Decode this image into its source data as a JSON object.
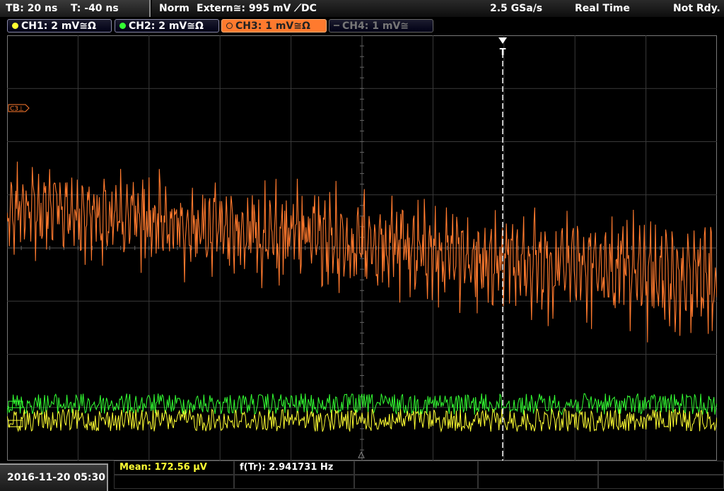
{
  "topbar": {
    "timebase": "TB: 20 ns",
    "trigger_time": "T: -40 ns",
    "mode": "Norm",
    "trigger_source": "Extern≅: 995 mV ⟋DC",
    "sample_rate": "2.5 GSa/s",
    "acq_mode": "Real Time",
    "status": "Not Rdy."
  },
  "channels": [
    {
      "label": "CH1: 2 mV≅Ω",
      "color": "#ffff33"
    },
    {
      "label": "CH2: 2 mV≅Ω",
      "color": "#33ff33"
    },
    {
      "label": "CH3: 1 mV≅Ω",
      "color": "#ff7a2e"
    },
    {
      "label": "CH4: 1 mV≅",
      "color": "#777777"
    }
  ],
  "display": {
    "ch3_marker": "C3⊥",
    "trigger_marker": "T"
  },
  "bottom": {
    "datetime": "2016-11-20 05:30",
    "mean": "Mean: 172.56 µV",
    "freq": "f(Tr): 2.941731 Hz"
  }
}
